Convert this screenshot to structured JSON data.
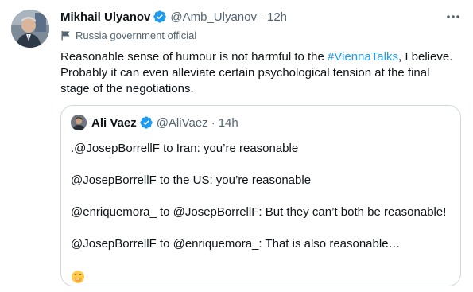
{
  "tweet": {
    "display_name": "Mikhail Ulyanov",
    "handle": "@Amb_Ulyanov",
    "separator": "·",
    "time": "12h",
    "account_label": "Russia government official",
    "text_before_hashtag": "Reasonable sense of humour is not harmful to the ",
    "hashtag": "#ViennaTalks",
    "text_after_hashtag": ", I believe. Probably it can even alleviate certain psychological tension at the final stage of the negotiations.",
    "more_icon": "more-horizontal-icon",
    "verified_icon": "verified-badge-icon",
    "label_icon": "flag-icon"
  },
  "quote": {
    "display_name": "Ali Vaez",
    "handle": "@AliVaez",
    "separator": "·",
    "time": "14h",
    "lines": [
      ".@JosepBorrellF to Iran: you’re reasonable",
      "@JosepBorrellF to the US: you’re reasonable",
      "@enriquemora_ to @JosepBorrellF: But they can’t both be reasonable!",
      "@JosepBorrellF to @enriquemora_: That is also reasonable…"
    ],
    "emoji": "face-with-hand-over-mouth-emoji"
  },
  "colors": {
    "accent": "#1d9bf0",
    "text": "#0f1419",
    "muted": "#536471",
    "border": "#cfd9de"
  }
}
